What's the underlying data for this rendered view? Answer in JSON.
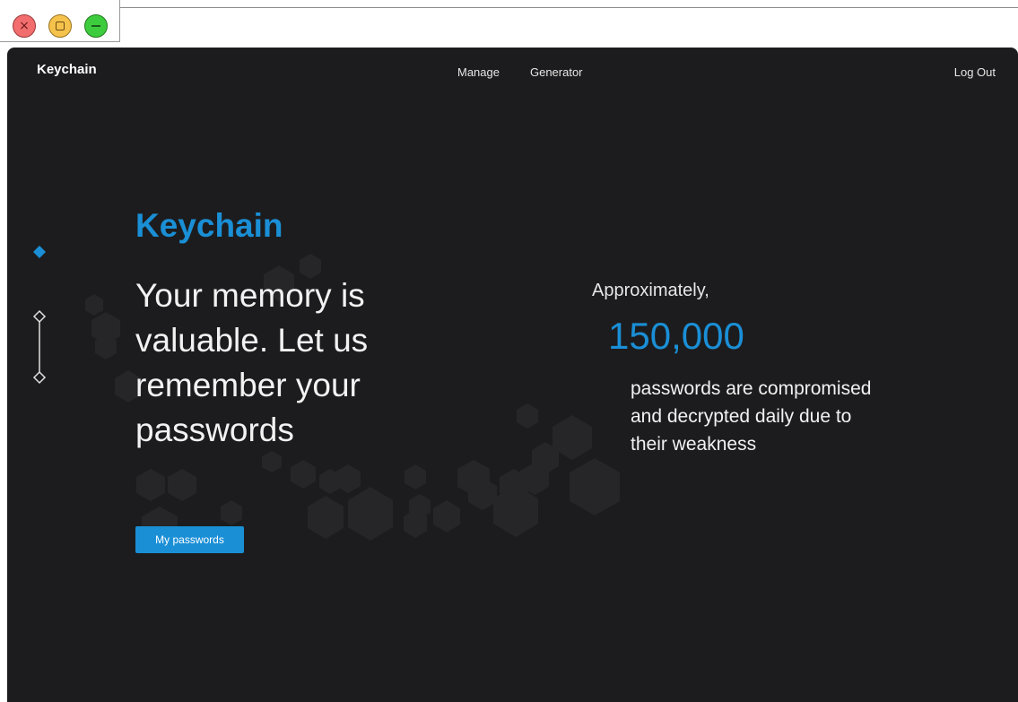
{
  "window": {
    "close_glyph": "×"
  },
  "nav": {
    "brand": "Keychain",
    "links": [
      "Manage",
      "Generator"
    ],
    "logout": "Log Out"
  },
  "hero": {
    "title": "Keychain",
    "tagline": "Your memory is valuable. Let us remember your passwords",
    "cta_label": "My passwords"
  },
  "stat": {
    "lead": "Approximately,",
    "number": "150,000",
    "description": "passwords are compromised and decrypted daily due to their weakness"
  },
  "indicator": {
    "slide_count": 2,
    "active_index": 0
  },
  "colors": {
    "accent": "#1a8fd6",
    "background": "#1c1c1e",
    "text": "#f2f2f2",
    "close": "#f26d6d",
    "maximize": "#f5c24c",
    "minimize": "#3dcc3d"
  },
  "icons": [
    "close-icon",
    "maximize-icon",
    "minimize-icon",
    "active-slide-dot-icon",
    "slide-connector-icon"
  ]
}
